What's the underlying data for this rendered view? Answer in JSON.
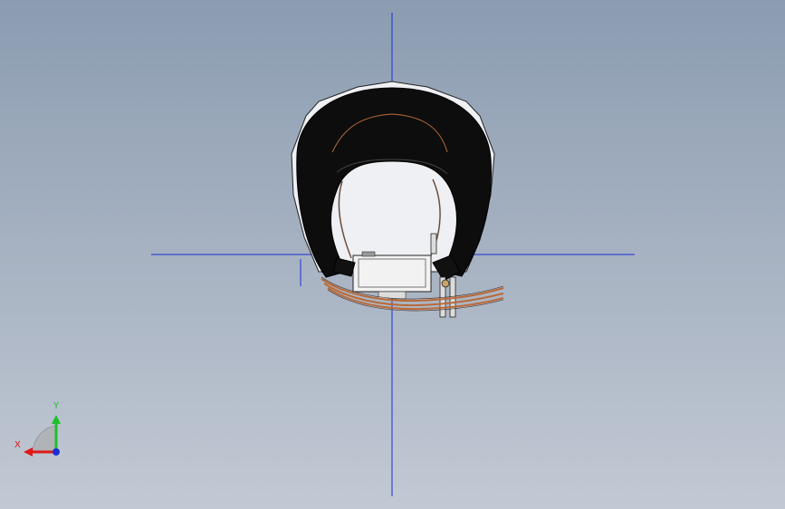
{
  "viewport": {
    "background_top": "#8b9cb1",
    "background_bottom": "#c2c9d4"
  },
  "crosshair": {
    "color": "#1a2fd6"
  },
  "model": {
    "shell_color": "#0d0d0d",
    "rim_color": "#eef0f3",
    "wire_color": "#b86a3a",
    "module_color": "#f2f2f2"
  },
  "triad": {
    "x_label": "X",
    "y_label": "Y",
    "x_color": "#e01818",
    "y_color": "#1fbf2a",
    "z_color": "#1a2fd6",
    "x_icon": "x-axis-arrow-icon",
    "y_icon": "y-axis-arrow-icon",
    "z_icon": "z-axis-dot-icon"
  }
}
